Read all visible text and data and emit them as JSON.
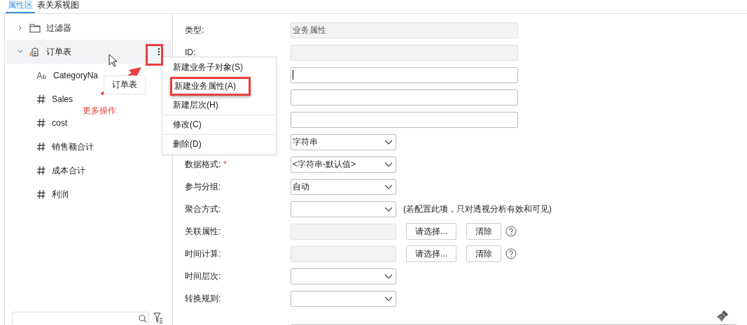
{
  "tabs": [
    {
      "label": "属性区",
      "selected": true
    },
    {
      "label": "表关系视图",
      "selected": false
    }
  ],
  "tree": [
    {
      "label": "过滤器",
      "kind": "folder",
      "expanded": false,
      "selected": false
    },
    {
      "label": "订单表",
      "kind": "table",
      "expanded": true,
      "selected": true,
      "children": [
        {
          "label": "CategoryNa",
          "kind": "text"
        },
        {
          "label": "Sales",
          "kind": "number"
        },
        {
          "label": "cost",
          "kind": "number"
        },
        {
          "label": "销售额合计",
          "kind": "number"
        },
        {
          "label": "成本合计",
          "kind": "number"
        },
        {
          "label": "利润",
          "kind": "number"
        }
      ]
    }
  ],
  "tooltip": "订单表",
  "annotation": "更多操作",
  "context_menu": [
    {
      "label": "新建业务子对象(S)",
      "separator_before": false,
      "highlighted": false
    },
    {
      "label": "新建业务属性(A)",
      "separator_before": false,
      "highlighted": true
    },
    {
      "label": "新建层次(H)",
      "separator_before": false,
      "highlighted": false
    },
    {
      "label": "修改(C)",
      "separator_before": true,
      "highlighted": false
    },
    {
      "label": "删除(D)",
      "separator_before": true,
      "highlighted": false
    }
  ],
  "form": [
    {
      "kind": "text",
      "label": "类型:",
      "value": "业务属性",
      "disabled": true
    },
    {
      "kind": "text",
      "label": "ID:",
      "disabled": true
    },
    {
      "kind": "text",
      "focused": true
    },
    {
      "kind": "text"
    },
    {
      "kind": "text"
    },
    {
      "kind": "select",
      "value": "字符串"
    },
    {
      "kind": "select",
      "label": "数据格式:",
      "required_mark": "*",
      "value": "<字符串-默认值>"
    },
    {
      "kind": "select",
      "label": "参与分组:",
      "value": "自动"
    },
    {
      "kind": "select",
      "label": "聚合方式:",
      "note": "(若配置此项，只对透视分析有效和可见)"
    },
    {
      "kind": "picker",
      "label": "关联属性:",
      "buttons": [
        "请选择...",
        "清除"
      ]
    },
    {
      "kind": "picker",
      "label": "时间计算:",
      "buttons": [
        "请选择...",
        "清除"
      ]
    },
    {
      "kind": "select",
      "label": "时间层次:"
    },
    {
      "kind": "select",
      "label": "转换规则:"
    },
    {
      "kind": "area"
    }
  ]
}
